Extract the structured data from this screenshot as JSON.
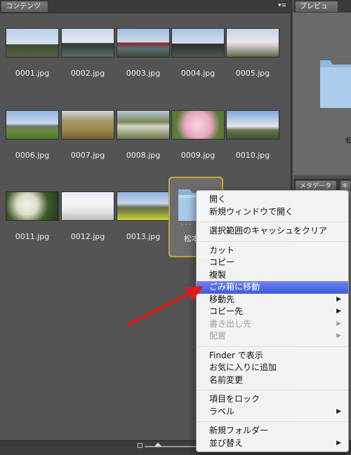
{
  "content_panel": {
    "tab_label": "コンテンツ",
    "menu_icon": "panel-menu-icon",
    "thumbnails": [
      {
        "label": "0001.jpg"
      },
      {
        "label": "0002.jpg"
      },
      {
        "label": "0003.jpg"
      },
      {
        "label": "0004.jpg"
      },
      {
        "label": "0005.jpg"
      },
      {
        "label": "0006.jpg"
      },
      {
        "label": "0007.jpg"
      },
      {
        "label": "0008.jpg"
      },
      {
        "label": "0009.jpg"
      },
      {
        "label": "0010.jpg"
      },
      {
        "label": "0011.jpg"
      },
      {
        "label": "0012.jpg"
      },
      {
        "label": "0013.jpg"
      }
    ],
    "selected_folder": {
      "label": "松本",
      "icon": "folder-icon",
      "selection_color": "#c9a43a"
    }
  },
  "preview_panel": {
    "tab_label": "プレビュー",
    "folder_icon": "folder-icon",
    "caption": "松"
  },
  "metadata_panel": {
    "tab_label": "メタデータ",
    "second_tab": "キ"
  },
  "context_menu": {
    "groups": [
      [
        {
          "label": "開く"
        },
        {
          "label": "新規ウィンドウで開く"
        }
      ],
      [
        {
          "label": "選択範囲のキャッシュをクリア"
        }
      ],
      [
        {
          "label": "カット"
        },
        {
          "label": "コピー"
        },
        {
          "label": "複製"
        },
        {
          "label": "ごみ箱に移動",
          "highlighted": true
        },
        {
          "label": "移動先",
          "submenu": true
        },
        {
          "label": "コピー先",
          "submenu": true
        },
        {
          "label": "書き出し先",
          "submenu": true,
          "disabled": true
        },
        {
          "label": "配置",
          "submenu": true,
          "disabled": true
        }
      ],
      [
        {
          "label": "Finder で表示"
        },
        {
          "label": "お気に入りに追加"
        },
        {
          "label": "名前変更"
        }
      ],
      [
        {
          "label": "項目をロック"
        },
        {
          "label": "ラベル",
          "submenu": true
        }
      ],
      [
        {
          "label": "新規フォルダー"
        },
        {
          "label": "並び替え",
          "submenu": true
        }
      ]
    ],
    "highlight_color": "#3d5be0"
  },
  "annotation": {
    "arrow_color": "#e01a1a",
    "icon": "red-arrow-icon"
  },
  "colors": {
    "background": "#545454",
    "selection": "#c9a43a"
  }
}
